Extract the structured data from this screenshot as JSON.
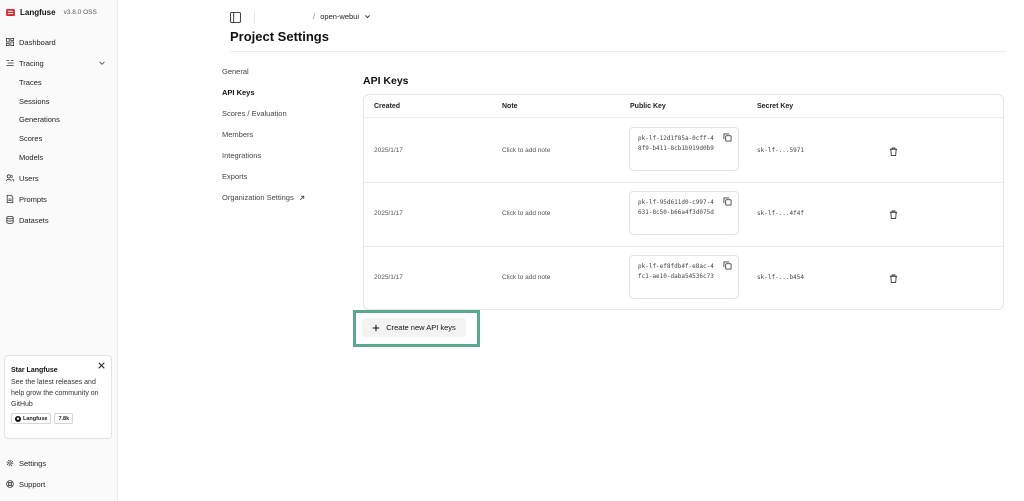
{
  "brand": {
    "name": "Langfuse",
    "version": "v3.8.0 OSS"
  },
  "sidebar": {
    "items": [
      {
        "label": "Dashboard",
        "icon": "dashboard-icon"
      },
      {
        "label": "Tracing",
        "icon": "tracing-icon"
      },
      {
        "label": "Users",
        "icon": "users-icon"
      },
      {
        "label": "Prompts",
        "icon": "file-text-icon"
      },
      {
        "label": "Datasets",
        "icon": "database-icon"
      }
    ],
    "tracing_sub": [
      "Traces",
      "Sessions",
      "Generations",
      "Scores",
      "Models"
    ],
    "footer": [
      {
        "label": "Settings",
        "icon": "gear-icon"
      },
      {
        "label": "Support",
        "icon": "lifebuoy-icon"
      }
    ]
  },
  "star_card": {
    "title": "Star Langfuse",
    "text": "See the latest releases and help grow the community on GitHub",
    "badge_label": "Langfuse",
    "badge_count": "7.8k"
  },
  "header": {
    "project": "open-webui",
    "title": "Project Settings"
  },
  "settings_nav": [
    "General",
    "API Keys",
    "Scores / Evaluation",
    "Members",
    "Integrations",
    "Exports",
    "Organization Settings"
  ],
  "api_keys": {
    "title": "API Keys",
    "columns": [
      "Created",
      "Note",
      "Public Key",
      "Secret Key"
    ],
    "rows": [
      {
        "created": "2025/1/17",
        "note": "Click to add note",
        "public_key": "pk-lf-12d1f85a-0cff-48f9-b411-8cb1b919d0b9",
        "secret_key": "sk-lf-...5971"
      },
      {
        "created": "2025/1/17",
        "note": "Click to add note",
        "public_key": "pk-lf-95d611d0-c997-4631-8c50-b66a4f3d075d",
        "secret_key": "sk-lf-...4f4f"
      },
      {
        "created": "2025/1/17",
        "note": "Click to add note",
        "public_key": "pk-lf-ef8fdb4f-e8ac-4fc1-ae10-daba54536c73",
        "secret_key": "sk-lf-...b454"
      }
    ],
    "create_label": "Create new API keys"
  },
  "colors": {
    "highlight": "#5aa890",
    "brand_red": "#e0242e"
  }
}
